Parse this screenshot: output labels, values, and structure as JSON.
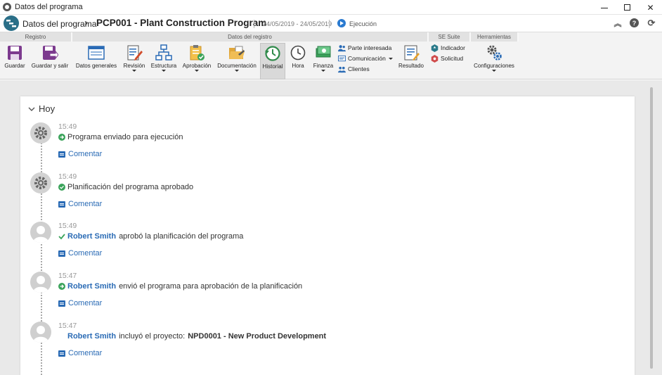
{
  "window": {
    "title": "Datos del programa"
  },
  "header": {
    "module": "Datos del programa",
    "record_title": "PCP001 - Plant Construction Program",
    "dates": "24/05/2019 - 24/05/2019",
    "status": "Ejecución"
  },
  "ribbon": {
    "groups": {
      "registro": "Registro",
      "datos": "Datos del registro",
      "suite": "SE Suite",
      "herramientas": "Herramientas"
    },
    "buttons": {
      "guardar": "Guardar",
      "guardar_salir": "Guardar y salir",
      "datos_generales": "Datos generales",
      "revision": "Revisión",
      "estructura": "Estructura",
      "aprobacion": "Aprobación",
      "documentacion": "Documentación",
      "historial": "Historial",
      "hora": "Hora",
      "finanza": "Finanza",
      "parte_interesada": "Parte interesada",
      "comunicacion": "Comunicación",
      "clientes": "Clientes",
      "resultado": "Resultado",
      "indicador": "Indicador",
      "solicitud": "Solicitud",
      "configuraciones": "Configuraciones"
    }
  },
  "history": {
    "section_label": "Hoy",
    "comment_label": "Comentar",
    "entries": [
      {
        "time": "15:49",
        "user": "",
        "text": "Programa enviado para ejecución",
        "object": "",
        "icon": "arrow-right-icon"
      },
      {
        "time": "15:49",
        "user": "",
        "text": "Planificación del programa aprobado",
        "object": "",
        "icon": "check-circle-icon"
      },
      {
        "time": "15:49",
        "user": "Robert Smith",
        "text": "aprobó la planificación del programa",
        "object": "",
        "icon": "check-icon"
      },
      {
        "time": "15:47",
        "user": "Robert Smith",
        "text": "envió el programa para aprobación de la planificación",
        "object": "",
        "icon": "arrow-right-icon"
      },
      {
        "time": "15:47",
        "user": "Robert Smith",
        "text": "incluyó el proyecto:",
        "object": "NPD0001 - New Product Development",
        "icon": ""
      }
    ]
  }
}
